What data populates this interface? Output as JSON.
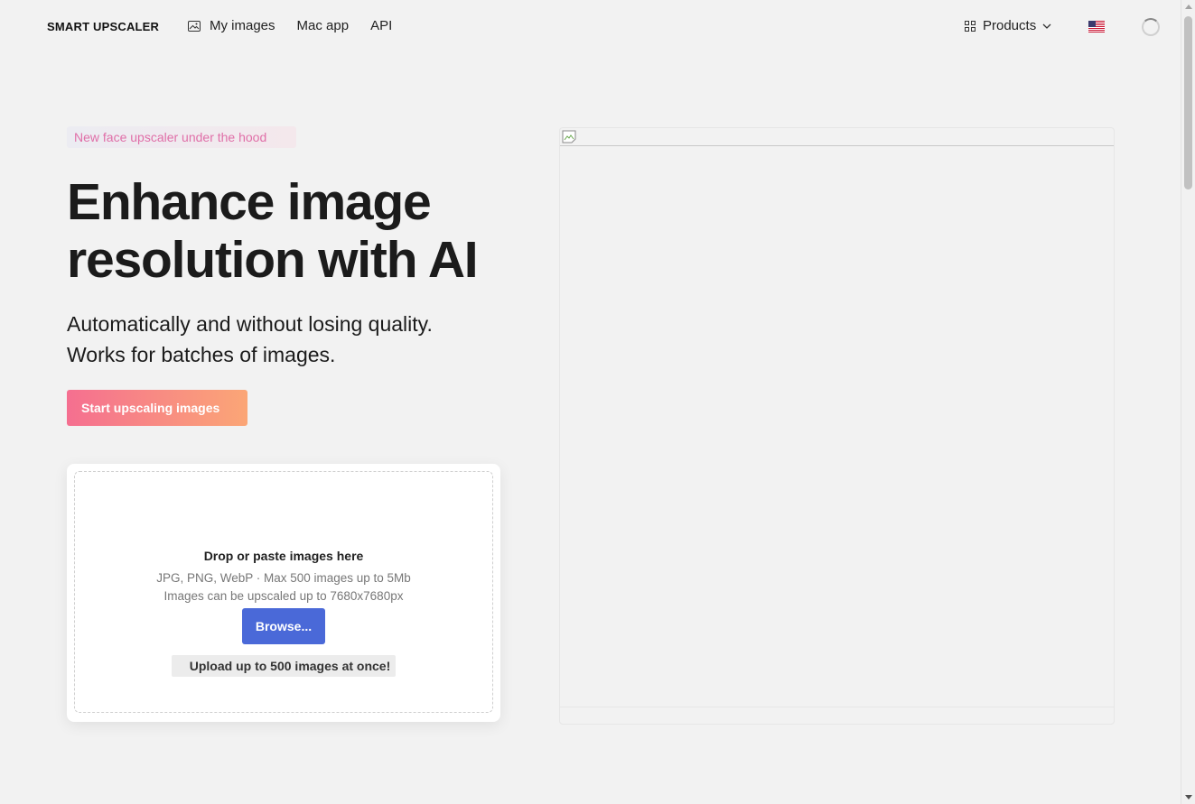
{
  "nav": {
    "logo": "SMART UPSCALER",
    "links": [
      {
        "label": "My images",
        "icon": "image-icon"
      },
      {
        "label": "Mac app"
      },
      {
        "label": "API"
      }
    ],
    "products_label": "Products",
    "flag": "us-flag-icon"
  },
  "hero": {
    "badge": "New face upscaler under the hood",
    "title_line1": "Enhance image",
    "title_line2": "resolution with AI",
    "subtitle_line1": "Automatically and without losing quality.",
    "subtitle_line2": "Works for batches of images.",
    "cta_label": "Start upscaling images"
  },
  "dropzone": {
    "title": "Drop or paste images here",
    "formats": "JPG, PNG, WebP · Max 500 images up to 5Mb",
    "limit": "Images can be upscaled up to 7680x7680px",
    "browse_label": "Browse...",
    "upload_note": "Upload up to 500 images at once!"
  },
  "colors": {
    "background": "#f2f2f2",
    "browse": "#4a69d8",
    "cta_start": "#f56f90",
    "cta_end": "#fba676",
    "badge_text": "#e06fa8"
  }
}
